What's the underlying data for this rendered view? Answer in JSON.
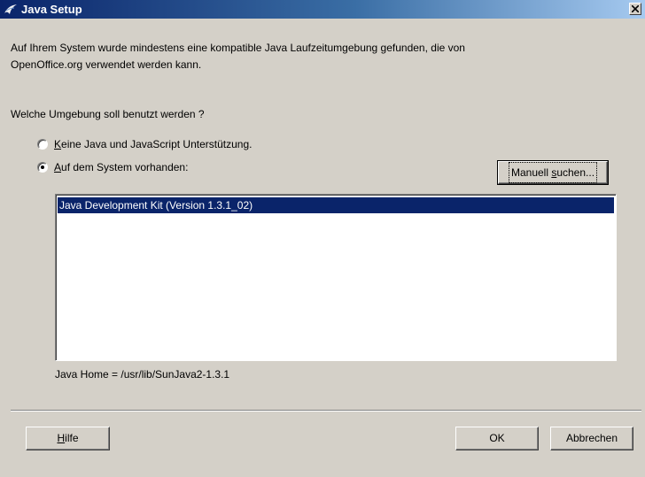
{
  "window": {
    "title": "Java Setup"
  },
  "intro": {
    "line1": "Auf Ihrem System wurde mindestens eine kompatible Java Laufzeitumgebung gefunden, die von",
    "line2": "OpenOffice.org verwendet werden kann."
  },
  "question": "Welche Umgebung soll benutzt werden ?",
  "options": {
    "none": {
      "access_key": "K",
      "label_rest": "eine Java und JavaScript Unterstützung.",
      "selected": false
    },
    "system": {
      "access_key": "A",
      "label_rest": "uf dem System vorhanden:",
      "selected": true
    }
  },
  "search_button": {
    "prefix": "Manuell ",
    "access_key": "s",
    "suffix": "uchen..."
  },
  "jre_list": {
    "items": [
      "Java Development Kit (Version 1.3.1_02)"
    ],
    "selected_index": 0
  },
  "java_home": "Java Home = /usr/lib/SunJava2-1.3.1",
  "footer": {
    "help": {
      "access_key": "H",
      "label_rest": "ilfe"
    },
    "ok": "OK",
    "cancel": "Abbrechen"
  },
  "colors": {
    "face": "#d4d0c8",
    "title_start": "#0a246a",
    "title_end": "#a6caf0",
    "selection": "#0a246a"
  }
}
